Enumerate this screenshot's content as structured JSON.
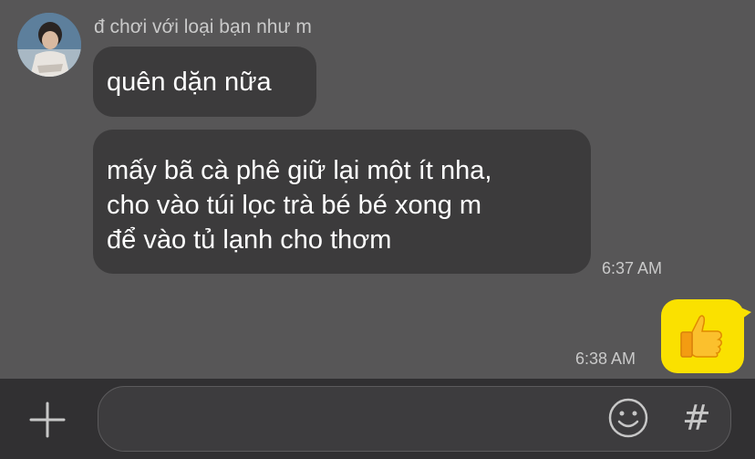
{
  "chat": {
    "sender_name": "đ chơi với loại bạn như m",
    "messages": [
      {
        "lines": [
          "quên dặn nữa"
        ]
      },
      {
        "lines": [
          "mấy bã cà phê giữ lại một ít nha,",
          "cho vào túi lọc trà bé bé xong m",
          "để vào tủ lạnh cho thơm"
        ],
        "time": "6:37 AM"
      }
    ],
    "own_message": {
      "emoji": "thumbs-up",
      "time": "6:38 AM"
    }
  },
  "composer": {
    "plus_icon": "plus-icon",
    "emoji_icon": "smiley-icon",
    "hashtag_label": "#"
  },
  "colors": {
    "background": "#575657",
    "bubble_incoming": "#3c3b3c",
    "bubble_outgoing": "#fae100",
    "input_bar": "#313032"
  }
}
